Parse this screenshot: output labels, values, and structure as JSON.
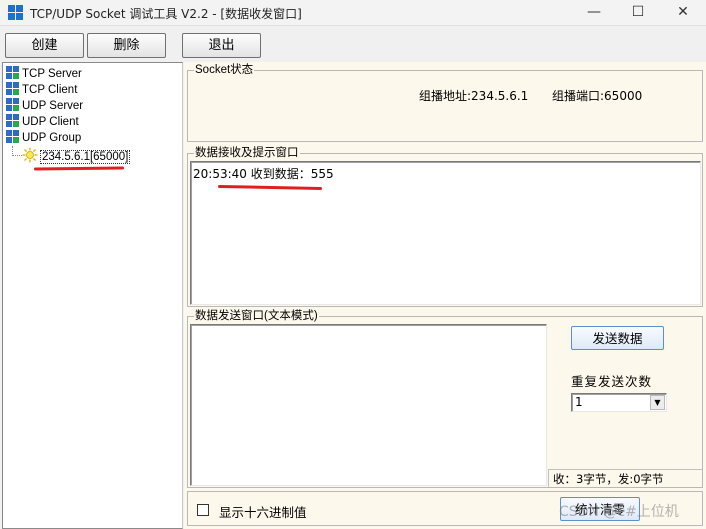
{
  "window": {
    "title": "TCP/UDP Socket 调试工具 V2.2 - [数据收发窗口]",
    "minimize": "—",
    "maximize": "☐",
    "close": "✕"
  },
  "toolbar": {
    "create": "创建",
    "delete": "删除",
    "exit": "退出"
  },
  "tree": {
    "items": [
      "TCP Server",
      "TCP Client",
      "UDP Server",
      "UDP Client",
      "UDP Group"
    ],
    "group_child": "234.5.6.1[65000]"
  },
  "socket_status": {
    "legend": "Socket状态",
    "group_address": "组播地址:234.5.6.1",
    "group_port": "组播端口:65000"
  },
  "receive": {
    "legend": "数据接收及提示窗口",
    "line": "20:53:40 收到数据：555"
  },
  "send": {
    "legend": "数据发送窗口(文本模式)",
    "text": "",
    "send_button": "发送数据",
    "repeat_label": "重复发送次数",
    "repeat_value": "1",
    "stats": "收：3字节，发:0字节",
    "clear_button": "统计清零",
    "hex_checkbox_label": "显示十六进制值"
  },
  "watermark": "CSDN @c#上位机",
  "colors": {
    "accent": "#1f6fd1",
    "panel_bg": "#fdf8ec",
    "annotation": "#e02020"
  }
}
